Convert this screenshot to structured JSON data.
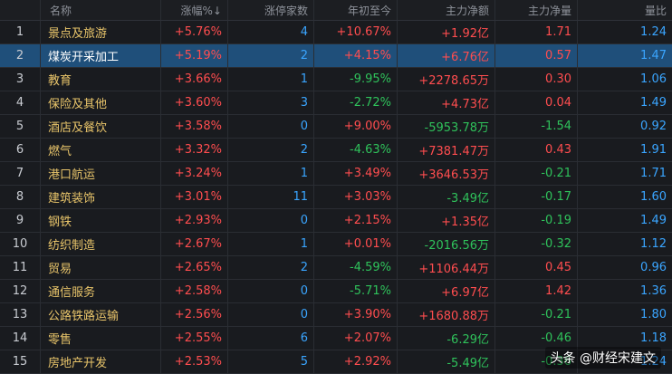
{
  "headers": {
    "name": "名称",
    "change": "涨幅%↓",
    "limit_up": "涨停家数",
    "ytd": "年初至今",
    "main_flow": "主力净额",
    "main_net": "主力净量",
    "vol_ratio": "量比"
  },
  "rows": [
    {
      "idx": "1",
      "name": "景点及旅游",
      "change": "+5.76%",
      "limit_up": "4",
      "ytd": "+10.67%",
      "main_flow": "+1.92亿",
      "main_net": "1.71",
      "vol_ratio": "1.24"
    },
    {
      "idx": "2",
      "name": "煤炭开采加工",
      "change": "+5.19%",
      "limit_up": "2",
      "ytd": "+4.15%",
      "main_flow": "+6.76亿",
      "main_net": "0.57",
      "vol_ratio": "1.47"
    },
    {
      "idx": "3",
      "name": "教育",
      "change": "+3.66%",
      "limit_up": "1",
      "ytd": "-9.95%",
      "main_flow": "+2278.65万",
      "main_net": "0.30",
      "vol_ratio": "1.06"
    },
    {
      "idx": "4",
      "name": "保险及其他",
      "change": "+3.60%",
      "limit_up": "3",
      "ytd": "-2.72%",
      "main_flow": "+4.73亿",
      "main_net": "0.04",
      "vol_ratio": "1.49"
    },
    {
      "idx": "5",
      "name": "酒店及餐饮",
      "change": "+3.58%",
      "limit_up": "0",
      "ytd": "+9.00%",
      "main_flow": "-5953.78万",
      "main_net": "-1.54",
      "vol_ratio": "0.92"
    },
    {
      "idx": "6",
      "name": "燃气",
      "change": "+3.32%",
      "limit_up": "2",
      "ytd": "-4.63%",
      "main_flow": "+7381.47万",
      "main_net": "0.43",
      "vol_ratio": "1.91"
    },
    {
      "idx": "7",
      "name": "港口航运",
      "change": "+3.24%",
      "limit_up": "1",
      "ytd": "+3.49%",
      "main_flow": "+3646.53万",
      "main_net": "-0.21",
      "vol_ratio": "1.71"
    },
    {
      "idx": "8",
      "name": "建筑装饰",
      "change": "+3.01%",
      "limit_up": "11",
      "ytd": "+3.03%",
      "main_flow": "-3.49亿",
      "main_net": "-0.17",
      "vol_ratio": "1.60"
    },
    {
      "idx": "9",
      "name": "钢铁",
      "change": "+2.93%",
      "limit_up": "0",
      "ytd": "+2.15%",
      "main_flow": "+1.35亿",
      "main_net": "-0.19",
      "vol_ratio": "1.49"
    },
    {
      "idx": "10",
      "name": "纺织制造",
      "change": "+2.67%",
      "limit_up": "1",
      "ytd": "+0.01%",
      "main_flow": "-2016.56万",
      "main_net": "-0.32",
      "vol_ratio": "1.12"
    },
    {
      "idx": "11",
      "name": "贸易",
      "change": "+2.65%",
      "limit_up": "2",
      "ytd": "-4.59%",
      "main_flow": "+1106.44万",
      "main_net": "0.45",
      "vol_ratio": "0.96"
    },
    {
      "idx": "12",
      "name": "通信服务",
      "change": "+2.58%",
      "limit_up": "0",
      "ytd": "-5.71%",
      "main_flow": "+6.97亿",
      "main_net": "1.42",
      "vol_ratio": "1.36"
    },
    {
      "idx": "13",
      "name": "公路铁路运输",
      "change": "+2.56%",
      "limit_up": "0",
      "ytd": "+3.90%",
      "main_flow": "+1680.88万",
      "main_net": "-0.21",
      "vol_ratio": "1.80"
    },
    {
      "idx": "14",
      "name": "零售",
      "change": "+2.55%",
      "limit_up": "6",
      "ytd": "+2.07%",
      "main_flow": "-6.29亿",
      "main_net": "-0.46",
      "vol_ratio": "1.18"
    },
    {
      "idx": "15",
      "name": "房地产开发",
      "change": "+2.53%",
      "limit_up": "5",
      "ytd": "+2.92%",
      "main_flow": "-5.49亿",
      "main_net": "-0.36",
      "vol_ratio": "1.24"
    }
  ],
  "selected_row": 1,
  "watermark": "头条 @财经宋建文",
  "colors": {
    "up": "#ff4d4f",
    "down": "#2fc25b",
    "count": "#3aa5ff",
    "selected": "#1f4f7a"
  }
}
